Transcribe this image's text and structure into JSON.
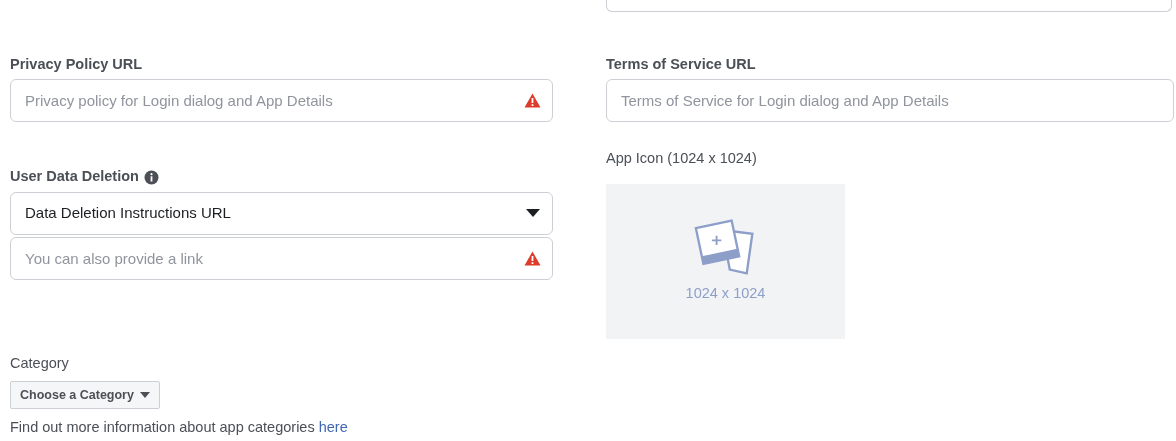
{
  "left": [
    {
      "kind": "input",
      "label": "Privacy Policy URL",
      "placeholder": "Privacy policy for Login dialog and App Details",
      "warning": true
    },
    {
      "kind": "select",
      "label": "User Data Deletion",
      "info": true,
      "value": "Data Deletion Instructions URL"
    },
    {
      "kind": "input",
      "placeholder": "You can also provide a link",
      "warning": true
    }
  ],
  "right": [
    {
      "kind": "input",
      "label": "Terms of Service URL",
      "placeholder": "Terms of Service for Login dialog and App Details",
      "warning": false
    }
  ],
  "app_icon": {
    "label": "App Icon (1024 x 1024)",
    "size": "1024 x 1024"
  },
  "category": {
    "label": "Category",
    "button": "Choose a Category",
    "help": "Find out more information about app categories ",
    "link": "here"
  }
}
